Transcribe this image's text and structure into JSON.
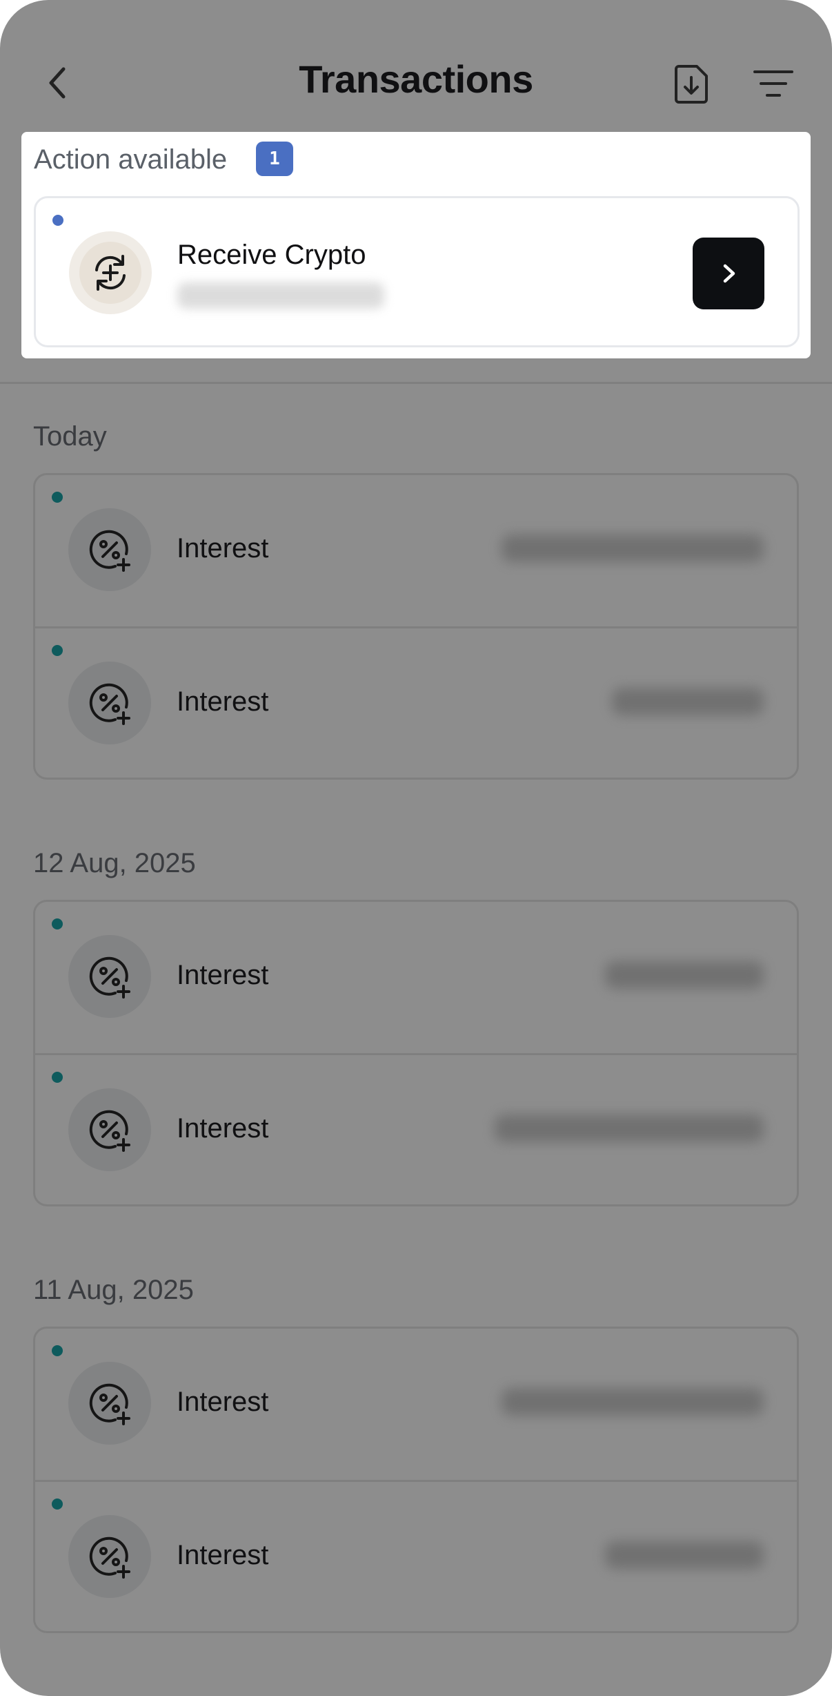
{
  "header": {
    "title": "Transactions",
    "icons": {
      "back": "chevron-left-icon",
      "download": "file-download-icon",
      "filter": "filter-lines-icon"
    }
  },
  "action": {
    "heading": "Action available",
    "badge_count": "1",
    "item": {
      "title": "Receive Crypto",
      "icon": "crypto-exchange-icon",
      "button_icon": "chevron-right-icon"
    }
  },
  "sections": [
    {
      "label": "Today",
      "rows": [
        {
          "title": "Interest"
        },
        {
          "title": "Interest"
        }
      ]
    },
    {
      "label": "12 Aug, 2025",
      "rows": [
        {
          "title": "Interest"
        },
        {
          "title": "Interest"
        }
      ]
    },
    {
      "label": "11 Aug, 2025",
      "rows": [
        {
          "title": "Interest"
        },
        {
          "title": "Interest"
        }
      ]
    }
  ],
  "colors": {
    "overlay_bg": "#8d8d8d",
    "badge_blue": "#4a6fc2",
    "teal_dot": "#0e5b5d",
    "button_dark": "#0d0f12"
  }
}
